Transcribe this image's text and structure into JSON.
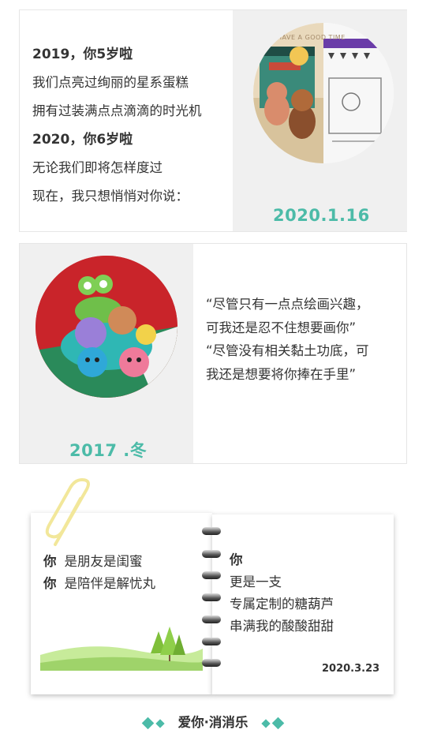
{
  "card1": {
    "lines": [
      {
        "text": "2019，你5岁啦",
        "bold": true
      },
      {
        "text": "我们点亮过绚丽的星系蛋糕",
        "bold": false
      },
      {
        "text": "拥有过装满点点滴滴的时光机",
        "bold": false
      },
      {
        "text": "2020，你6岁啦",
        "bold": true
      },
      {
        "text": "无论我们即将怎样度过",
        "bold": false
      },
      {
        "text": "现在，我只想悄悄对你说：",
        "bold": false
      }
    ],
    "photo_sign": "HAVE A GOOD TIME",
    "date": "2020.1.16"
  },
  "card2": {
    "date": "2017 .冬",
    "quotes": [
      "“尽管只有一点点绘画兴趣，",
      "可我还是忍不住想要画你”",
      "“尽管没有相关黏土功底，可",
      "我还是想要将你捧在手里”"
    ]
  },
  "notebook": {
    "left_lines": [
      {
        "key": "你",
        "text": "是朋友是闺蜜"
      },
      {
        "key": "你",
        "text": "是陪伴是解忧丸"
      }
    ],
    "right_title": "你",
    "right_lines": [
      "更是一支",
      "专属定制的糖葫芦",
      "串满我的酸酸甜甜"
    ],
    "date": "2020.3.23"
  },
  "footer": {
    "text": "爱你·消消乐"
  },
  "colors": {
    "accent": "#4cbba8",
    "panel": "#f0f0f0",
    "text": "#333333",
    "clip": "#f2e79a",
    "grass": "#9fd36a"
  }
}
